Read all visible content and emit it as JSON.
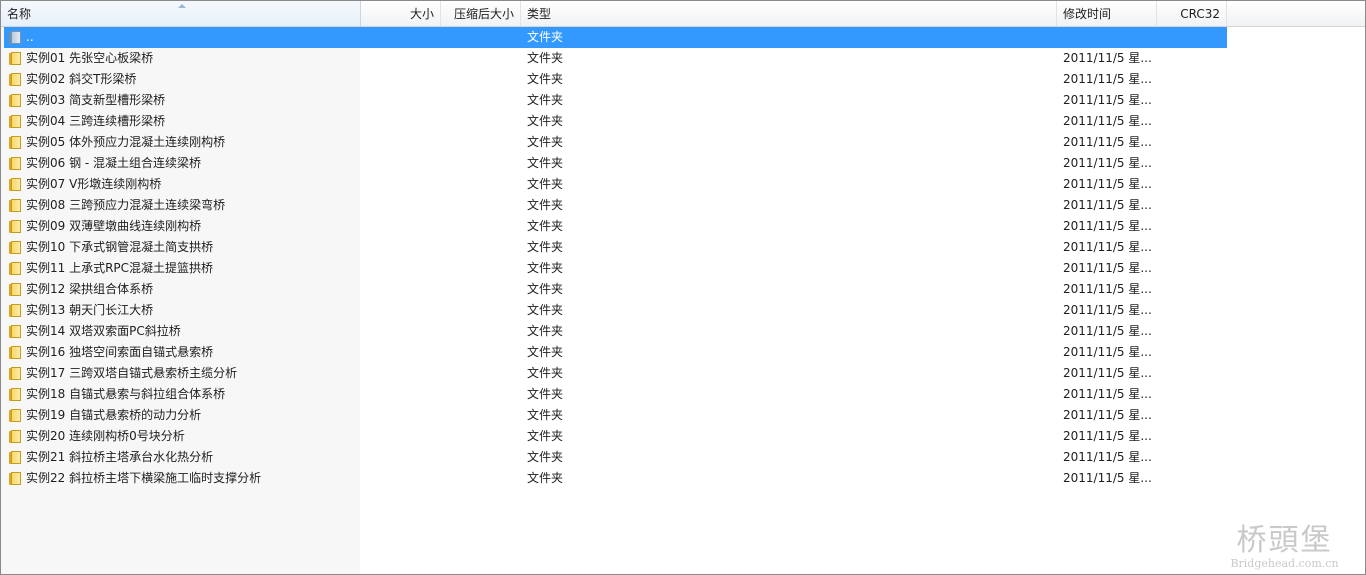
{
  "columns": {
    "name": "名称",
    "size": "大小",
    "packed": "压缩后大小",
    "type": "类型",
    "modified": "修改时间",
    "crc": "CRC32"
  },
  "parent_row": {
    "name": "..",
    "type": "文件夹"
  },
  "rows": [
    {
      "name": "实例01 先张空心板梁桥",
      "type": "文件夹",
      "modified": "2011/11/5 星..."
    },
    {
      "name": "实例02 斜交T形梁桥",
      "type": "文件夹",
      "modified": "2011/11/5 星..."
    },
    {
      "name": "实例03 简支新型槽形梁桥",
      "type": "文件夹",
      "modified": "2011/11/5 星..."
    },
    {
      "name": "实例04 三跨连续槽形梁桥",
      "type": "文件夹",
      "modified": "2011/11/5 星..."
    },
    {
      "name": "实例05 体外预应力混凝土连续刚构桥",
      "type": "文件夹",
      "modified": "2011/11/5 星..."
    },
    {
      "name": "实例06 钢 - 混凝土组合连续梁桥",
      "type": "文件夹",
      "modified": "2011/11/5 星..."
    },
    {
      "name": "实例07 V形墩连续刚构桥",
      "type": "文件夹",
      "modified": "2011/11/5 星..."
    },
    {
      "name": "实例08 三跨预应力混凝土连续梁弯桥",
      "type": "文件夹",
      "modified": "2011/11/5 星..."
    },
    {
      "name": "实例09 双薄壁墩曲线连续刚构桥",
      "type": "文件夹",
      "modified": "2011/11/5 星..."
    },
    {
      "name": "实例10 下承式钢管混凝土简支拱桥",
      "type": "文件夹",
      "modified": "2011/11/5 星..."
    },
    {
      "name": "实例11 上承式RPC混凝土提篮拱桥",
      "type": "文件夹",
      "modified": "2011/11/5 星..."
    },
    {
      "name": "实例12 梁拱组合体系桥",
      "type": "文件夹",
      "modified": "2011/11/5 星..."
    },
    {
      "name": "实例13 朝天门长江大桥",
      "type": "文件夹",
      "modified": "2011/11/5 星..."
    },
    {
      "name": "实例14 双塔双索面PC斜拉桥",
      "type": "文件夹",
      "modified": "2011/11/5 星..."
    },
    {
      "name": "实例16 独塔空间索面自锚式悬索桥",
      "type": "文件夹",
      "modified": "2011/11/5 星..."
    },
    {
      "name": "实例17 三跨双塔自锚式悬索桥主缆分析",
      "type": "文件夹",
      "modified": "2011/11/5 星..."
    },
    {
      "name": "实例18 自锚式悬索与斜拉组合体系桥",
      "type": "文件夹",
      "modified": "2011/11/5 星..."
    },
    {
      "name": "实例19 自锚式悬索桥的动力分析",
      "type": "文件夹",
      "modified": "2011/11/5 星..."
    },
    {
      "name": "实例20 连续刚构桥0号块分析",
      "type": "文件夹",
      "modified": "2011/11/5 星..."
    },
    {
      "name": "实例21 斜拉桥主塔承台水化热分析",
      "type": "文件夹",
      "modified": "2011/11/5 星..."
    },
    {
      "name": "实例22 斜拉桥主塔下横梁施工临时支撑分析",
      "type": "文件夹",
      "modified": "2011/11/5 星..."
    }
  ],
  "watermark": {
    "title": "桥頭堡",
    "url": "Bridgehead.com.cn"
  },
  "colors": {
    "selection": "#3399ff",
    "folder": "#f7d86a"
  }
}
